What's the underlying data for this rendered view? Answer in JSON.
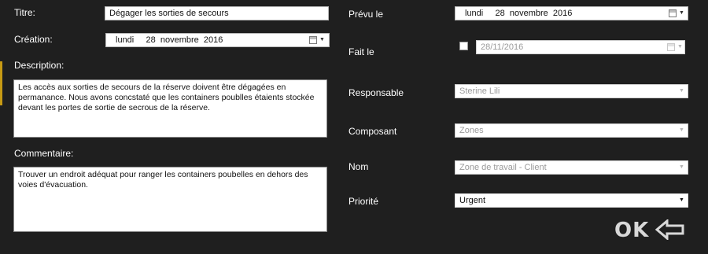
{
  "left": {
    "titre_label": "Titre:",
    "titre_value": "Dégager les sorties de secours",
    "creation_label": "Création:",
    "creation_value": "lundi     28  novembre  2016",
    "description_label": "Description:",
    "description_value": "Les accès aux sorties de secours de la réserve doivent être dégagées en permanance.  Nous avons concstaté que les containers poublles étaients stockée devant les portes de sortie de secrous de la réserve.",
    "commentaire_label": "Commentaire:",
    "commentaire_value": "Trouver un endroit adéquat pour ranger les containers poubelles en dehors des voies d'évacuation."
  },
  "right": {
    "prevu_label": "Prévu le",
    "prevu_value": "lundi     28  novembre  2016",
    "fait_label": "Fait le",
    "fait_value": "28/11/2016",
    "responsable_label": "Responsable",
    "responsable_value": "Sterine Lili",
    "composant_label": "Composant",
    "composant_value": "Zones",
    "nom_label": "Nom",
    "nom_value": "Zone de travail - Client",
    "priorite_label": "Priorité",
    "priorite_value": "Urgent"
  },
  "ok_label": "OK",
  "icons": {
    "calendar": "calendar-icon",
    "dropdown": "chevron-down-icon",
    "ok_arrow": "arrow-left-icon"
  },
  "colors": {
    "background": "#1f1f1f",
    "accent_strip": "#c79a14"
  }
}
